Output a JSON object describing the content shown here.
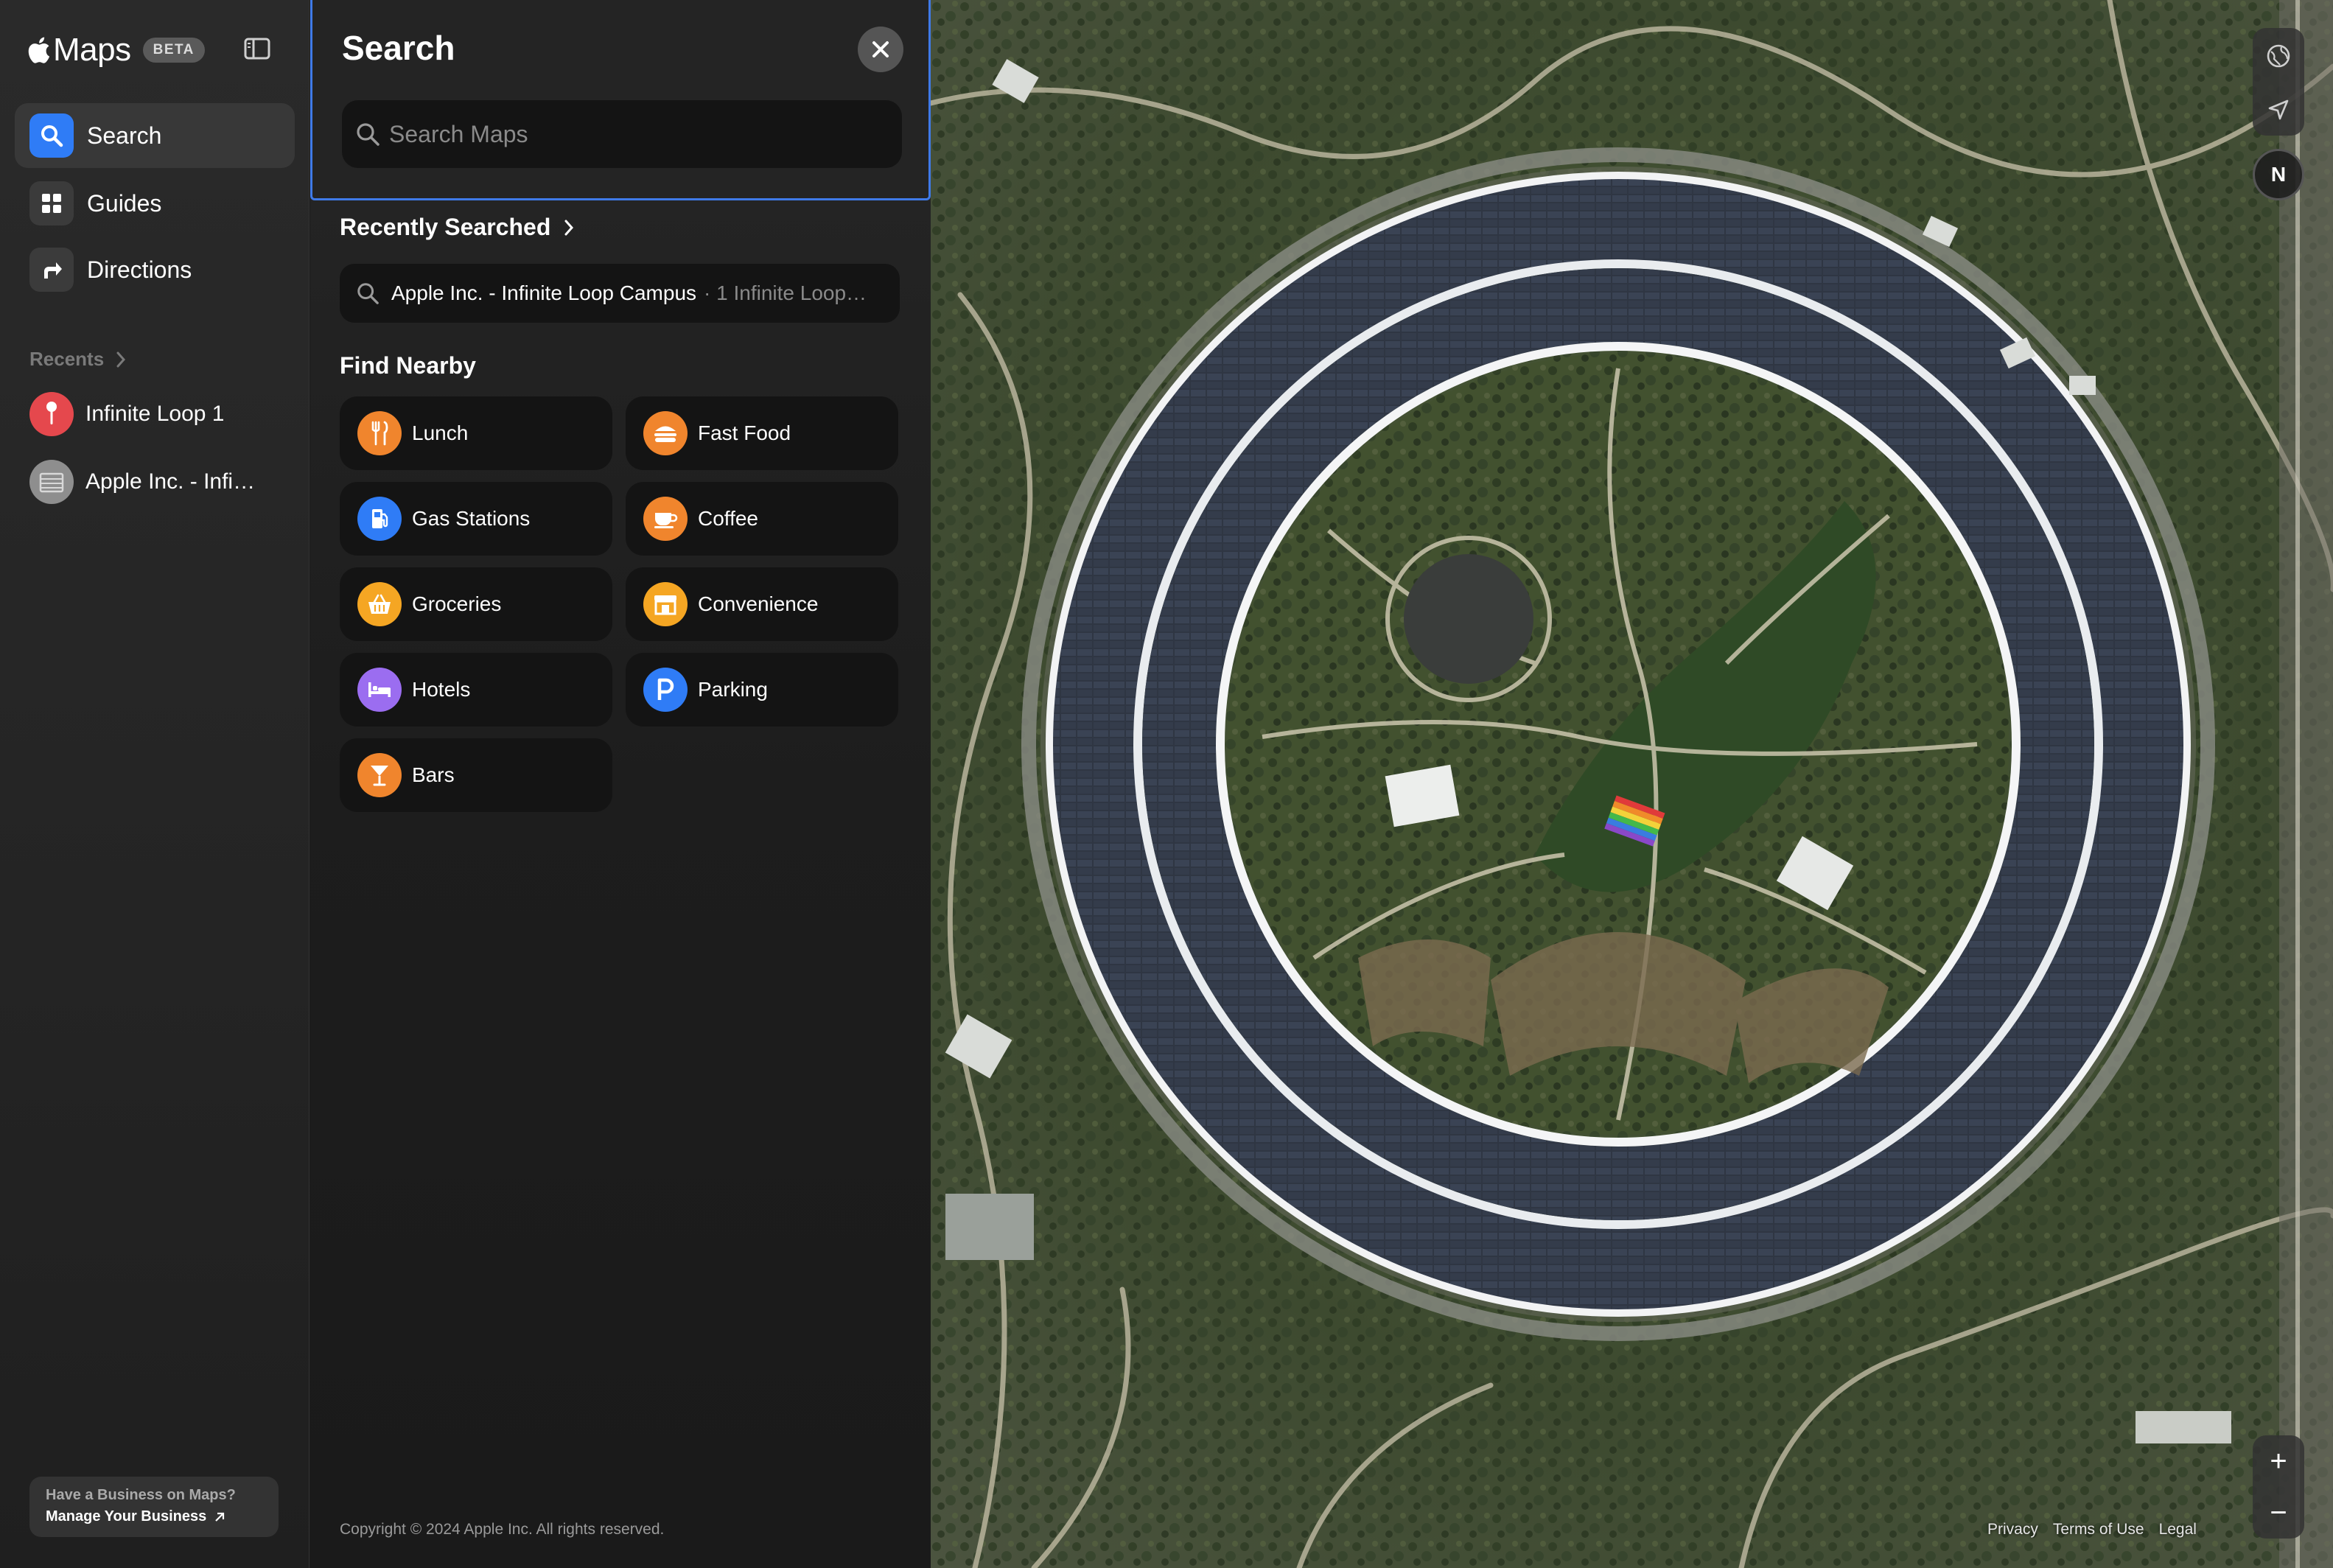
{
  "app": {
    "name": "Maps",
    "badge": "BETA"
  },
  "sidebar": {
    "nav": [
      {
        "label": "Search",
        "icon": "search-icon",
        "active": true
      },
      {
        "label": "Guides",
        "icon": "grid-icon",
        "active": false
      },
      {
        "label": "Directions",
        "icon": "directions-arrow-icon",
        "active": false
      }
    ],
    "recents_label": "Recents",
    "recents": [
      {
        "label": "Infinite Loop 1",
        "icon": "pin-icon",
        "color": "#e5484d"
      },
      {
        "label": "Apple Inc. - Infi…",
        "icon": "building-icon",
        "color": "#8e8e8e"
      }
    ],
    "business": {
      "line1": "Have a Business on Maps?",
      "line2": "Manage Your Business"
    }
  },
  "search_panel": {
    "title": "Search",
    "search_placeholder": "Search Maps",
    "recently_searched_label": "Recently Searched",
    "recent_search": {
      "title": "Apple Inc. - Infinite Loop Campus",
      "subtitle": "· 1 Infinite Loop…"
    },
    "find_nearby_label": "Find Nearby",
    "nearby": [
      {
        "label": "Lunch",
        "icon": "fork-knife-icon",
        "color": "#f0852d"
      },
      {
        "label": "Fast Food",
        "icon": "burger-icon",
        "color": "#f0852d"
      },
      {
        "label": "Gas Stations",
        "icon": "fuel-pump-icon",
        "color": "#2f7cf6"
      },
      {
        "label": "Coffee",
        "icon": "coffee-cup-icon",
        "color": "#f0852d"
      },
      {
        "label": "Groceries",
        "icon": "basket-icon",
        "color": "#f5a623"
      },
      {
        "label": "Convenience",
        "icon": "storefront-icon",
        "color": "#f5a623"
      },
      {
        "label": "Hotels",
        "icon": "bed-icon",
        "color": "#9b6df0"
      },
      {
        "label": "Parking",
        "icon": "parking-icon",
        "color": "#2f7cf6"
      },
      {
        "label": "Bars",
        "icon": "cocktail-icon",
        "color": "#f0852d"
      }
    ],
    "copyright": "Copyright © 2024 Apple Inc. All rights reserved."
  },
  "map": {
    "compass_label": "N",
    "zoom_in": "+",
    "zoom_out": "−",
    "links": [
      "Privacy",
      "Terms of Use",
      "Legal"
    ]
  }
}
